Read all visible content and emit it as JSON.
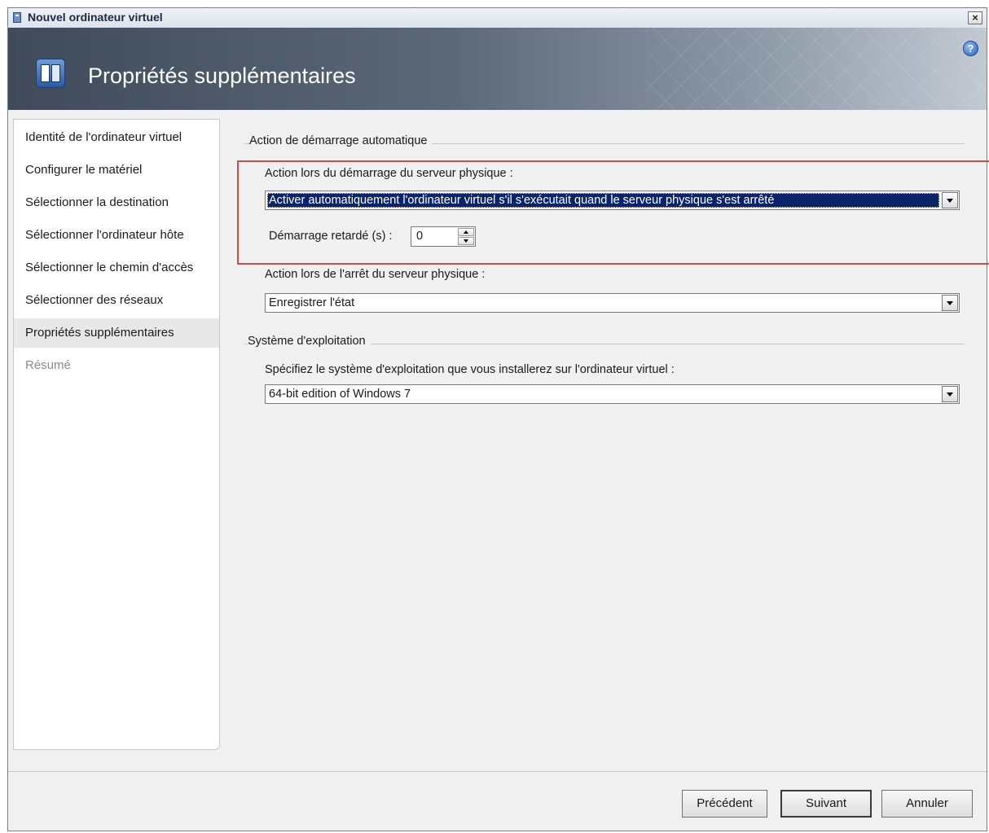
{
  "window": {
    "title": "Nouvel ordinateur virtuel",
    "close_glyph": "×"
  },
  "banner": {
    "title": "Propriétés supplémentaires",
    "help_glyph": "?"
  },
  "sidebar": {
    "items": [
      {
        "label": "Identité de l'ordinateur virtuel",
        "state": "normal"
      },
      {
        "label": "Configurer le matériel",
        "state": "normal"
      },
      {
        "label": "Sélectionner la destination",
        "state": "normal"
      },
      {
        "label": "Sélectionner l'ordinateur hôte",
        "state": "normal"
      },
      {
        "label": "Sélectionner le chemin d'accès",
        "state": "normal"
      },
      {
        "label": "Sélectionner des réseaux",
        "state": "normal"
      },
      {
        "label": "Propriétés supplémentaires",
        "state": "active"
      },
      {
        "label": "Résumé",
        "state": "disabled"
      }
    ]
  },
  "auto_start": {
    "group_label": "Action de démarrage automatique",
    "startup_label": "Action lors du démarrage du serveur physique :",
    "startup_value": "Activer automatiquement l'ordinateur virtuel s'il s'exécutait quand le serveur physique s'est arrêté",
    "delay_label": "Démarrage retardé (s) :",
    "delay_value": "0",
    "shutdown_label": "Action lors de l'arrêt du serveur physique :",
    "shutdown_value": "Enregistrer l'état"
  },
  "os": {
    "group_label": "Système d'exploitation",
    "label": "Spécifiez le système d'exploitation que vous installerez sur l'ordinateur virtuel :",
    "value": "64-bit edition of Windows 7"
  },
  "footer": {
    "previous": "Précédent",
    "next": "Suivant",
    "cancel": "Annuler"
  },
  "colors": {
    "highlight_box": "#c74c4c",
    "selection": "#0a246a"
  }
}
